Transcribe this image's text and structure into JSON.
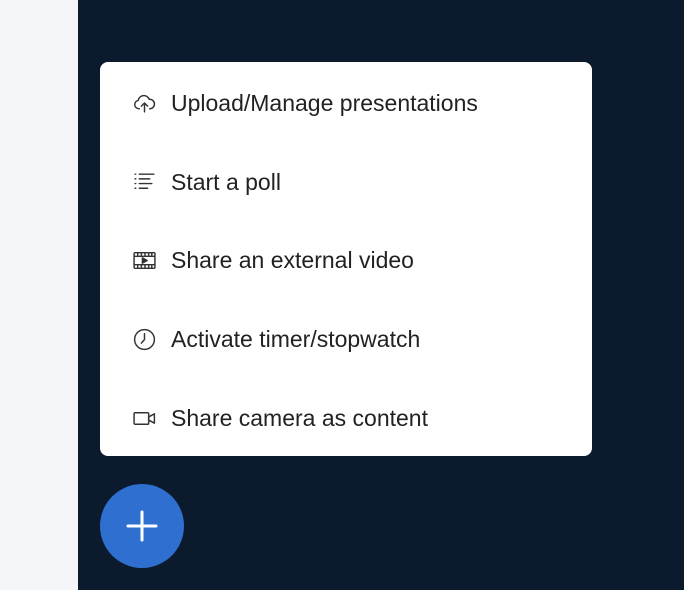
{
  "colors": {
    "background": "#0b1a2d",
    "left_panel": "#f3f5f9",
    "menu_background": "#ffffff",
    "menu_text": "#222222",
    "fab": "#2f6fd0"
  },
  "menu": {
    "items": [
      {
        "label": "Upload/Manage presentations",
        "icon": "cloud-upload-icon"
      },
      {
        "label": "Start a poll",
        "icon": "list-icon"
      },
      {
        "label": "Share an external video",
        "icon": "video-film-icon"
      },
      {
        "label": "Activate timer/stopwatch",
        "icon": "clock-icon"
      },
      {
        "label": "Share camera as content",
        "icon": "camera-icon"
      }
    ]
  },
  "fab": {
    "icon": "plus-icon"
  }
}
